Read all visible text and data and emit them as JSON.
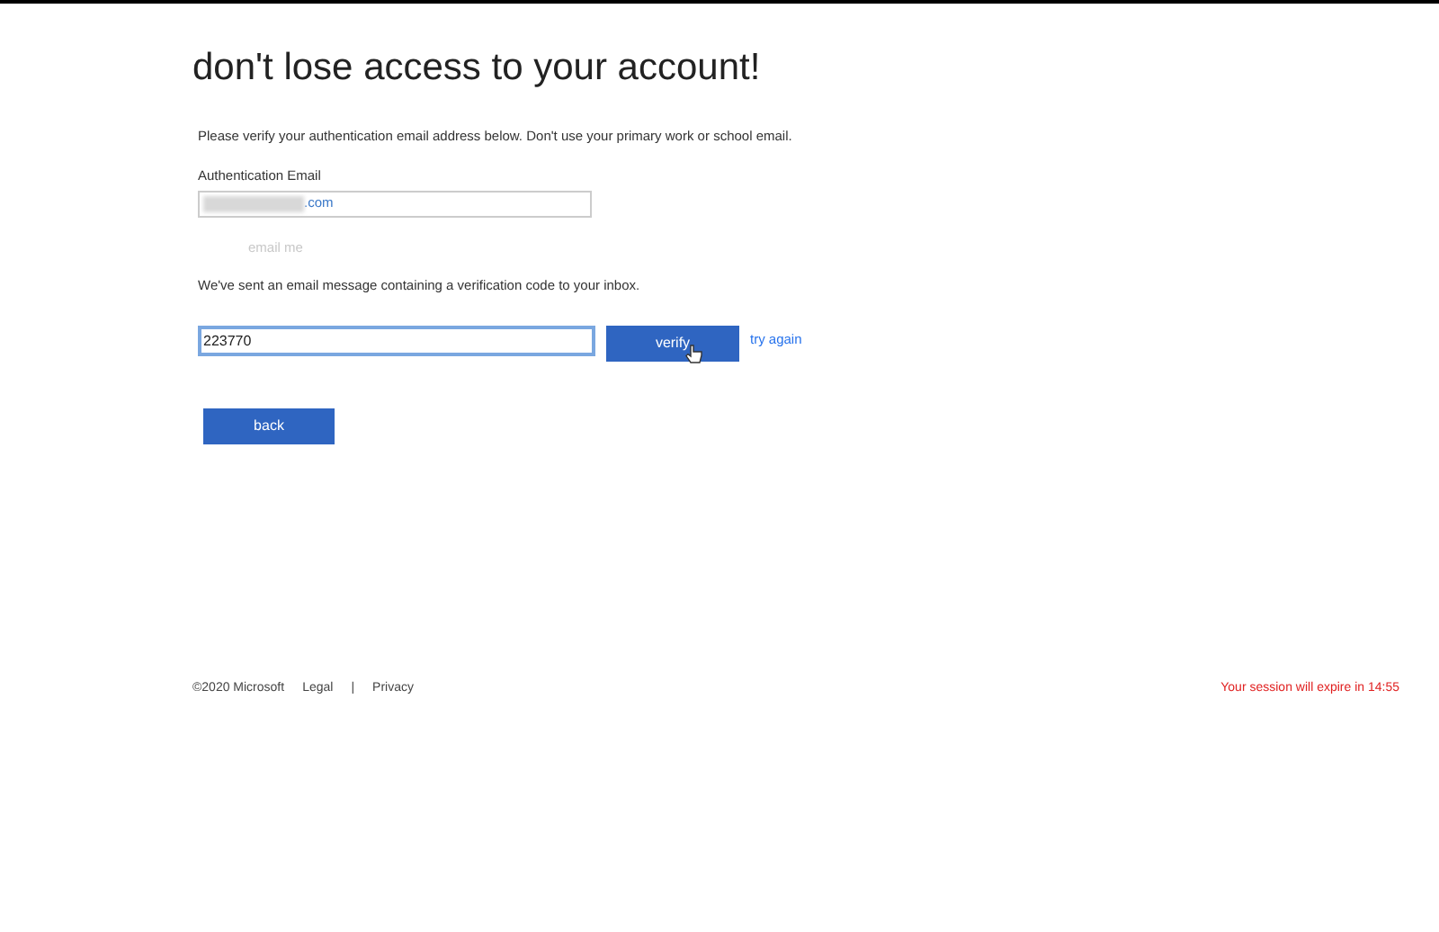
{
  "heading": "don't lose access to your account!",
  "intro": "Please verify your authentication email address below. Don't use your primary work or school email.",
  "email_field": {
    "label": "Authentication Email",
    "value": ".com",
    "redacted": true
  },
  "email_me": {
    "label": "email me",
    "disabled": true
  },
  "sent_message": "We've sent an email message containing a verification code to your inbox.",
  "code_field": {
    "value": "223770",
    "focused": true
  },
  "verify_button": "verify",
  "try_again_link": "try again",
  "back_button": "back",
  "footer": {
    "copyright": "©2020 Microsoft",
    "links": [
      "Legal",
      "Privacy"
    ],
    "separator": "|",
    "session_notice": "Your session will expire in 14:55"
  }
}
